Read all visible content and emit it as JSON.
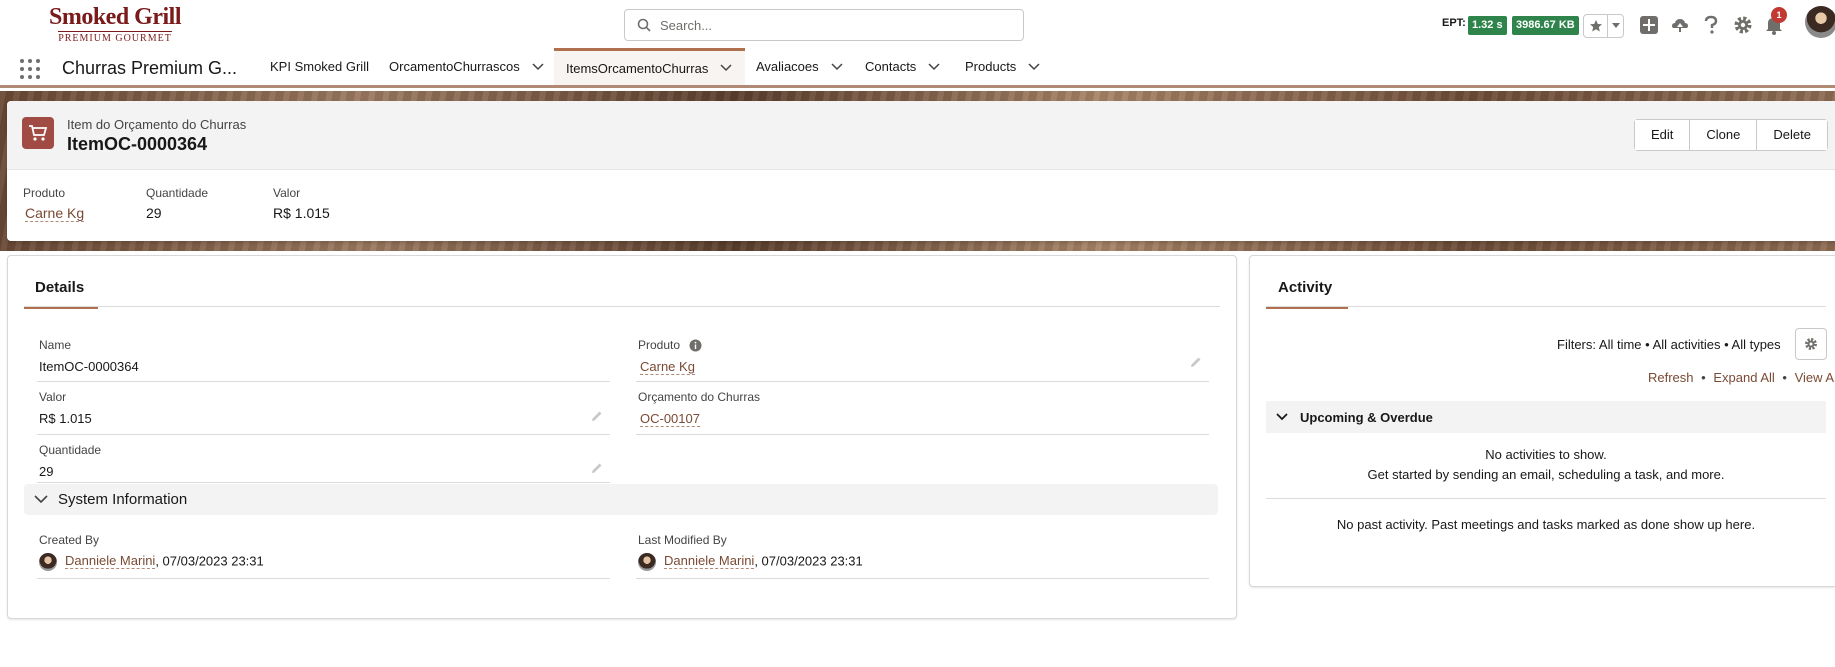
{
  "header": {
    "logo_line1": "Smoked Grill",
    "logo_line2": "PREMIUM GOURMET",
    "search_placeholder": "Search...",
    "ept_label": "EPT:",
    "ept_time": "1.32 s",
    "ept_size": "3986.67 KB",
    "notification_count": "1"
  },
  "nav": {
    "app_name": "Churras Premium G...",
    "items": [
      {
        "label": "KPI Smoked Grill",
        "dropdown": false,
        "active": false
      },
      {
        "label": "OrcamentoChurrascos",
        "dropdown": true,
        "active": false
      },
      {
        "label": "ItemsOrcamentoChurras",
        "dropdown": true,
        "active": true
      },
      {
        "label": "Avaliacoes",
        "dropdown": true,
        "active": false
      },
      {
        "label": "Contacts",
        "dropdown": true,
        "active": false
      },
      {
        "label": "Products",
        "dropdown": true,
        "active": false
      }
    ]
  },
  "record": {
    "type": "Item do Orçamento do Churras",
    "title": "ItemOC-0000364",
    "actions": [
      "Edit",
      "Clone",
      "Delete"
    ],
    "highlights": [
      {
        "label": "Produto",
        "value": "Carne Kg",
        "link": true
      },
      {
        "label": "Quantidade",
        "value": "29",
        "link": false
      },
      {
        "label": "Valor",
        "value": "R$ 1.015",
        "link": false
      }
    ]
  },
  "details": {
    "tab": "Details",
    "fields": {
      "name_label": "Name",
      "name_value": "ItemOC-0000364",
      "produto_label": "Produto",
      "produto_value": "Carne Kg",
      "valor_label": "Valor",
      "valor_value": "R$ 1.015",
      "orcamento_label": "Orçamento do Churras",
      "orcamento_value": "OC-00107",
      "quantidade_label": "Quantidade",
      "quantidade_value": "29"
    },
    "system_section": "System Information",
    "created_by_label": "Created By",
    "created_by_name": "Danniele Marini",
    "created_by_date": ", 07/03/2023 23:31",
    "modified_by_label": "Last Modified By",
    "modified_by_name": "Danniele Marini",
    "modified_by_date": ", 07/03/2023 23:31"
  },
  "activity": {
    "tab": "Activity",
    "filters": "Filters: All time • All activities • All types",
    "refresh": "Refresh",
    "expand_all": "Expand All",
    "view_all": "View All",
    "sep": "•",
    "upcoming": "Upcoming & Overdue",
    "no_activities": "No activities to show.",
    "get_started": "Get started by sending an email, scheduling a task, and more.",
    "no_past": "No past activity. Past meetings and tasks marked as done show up here."
  },
  "colors": {
    "accent": "#b06f4d",
    "link": "#7a4a34",
    "badge_green": "#2e844a",
    "record_icon": "#a04b43"
  },
  "icons": [
    "search-icon",
    "star-icon",
    "chevron-down-icon",
    "add-icon",
    "trailhead-icon",
    "help-icon",
    "gear-icon",
    "bell-icon",
    "waffle-icon",
    "cart-icon",
    "info-icon",
    "pencil-icon"
  ]
}
